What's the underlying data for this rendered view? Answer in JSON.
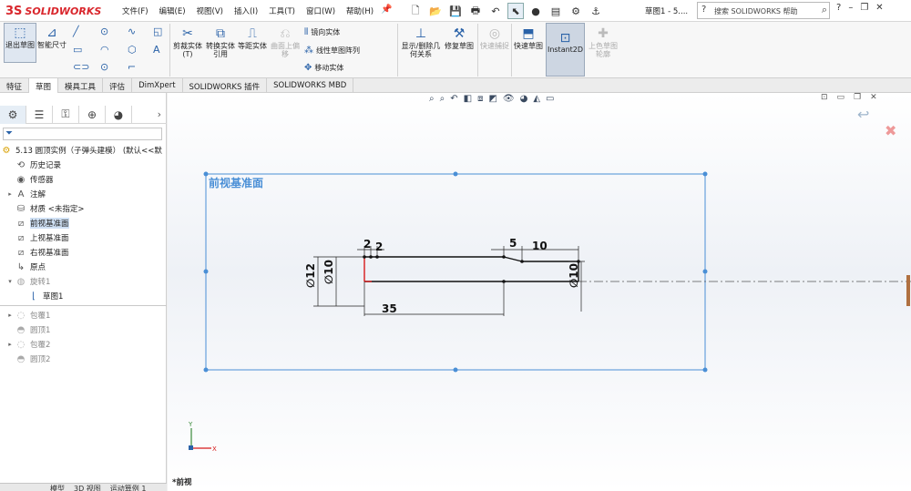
{
  "app": {
    "logo_mark": "3S",
    "logo_text": "SOLIDWORKS"
  },
  "menus": [
    "文件(F)",
    "编辑(E)",
    "视图(V)",
    "插入(I)",
    "工具(T)",
    "窗口(W)",
    "帮助(H)"
  ],
  "quick_icons": [
    "new-icon",
    "open-icon",
    "save-icon",
    "print-icon",
    "undo-icon",
    "select-icon",
    "traffic-light-icon",
    "options-icon",
    "gear-icon",
    "anchor-icon"
  ],
  "document_title": "草图1 - 5....",
  "search": {
    "placeholder": "搜索 SOLIDWORKS 帮助"
  },
  "ribbon": {
    "exit_sketch": "退出草图",
    "smart_dim": "智能尺寸",
    "trim": "剪裁实体(T)",
    "convert": "转换实体引用",
    "offset": "等距实体",
    "surface_offset": "曲面上偏移",
    "mirror": "镜向实体",
    "linear_pattern": "线性草图阵列",
    "move": "移动实体",
    "show_delete": "显示/删除几何关系",
    "repair": "修复草图",
    "quick_snap": "快速捕捉",
    "rapid_sketch": "快速草图",
    "instant2d": "Instant2D",
    "shaded": "上色草图轮廓"
  },
  "tabs": [
    "特征",
    "草图",
    "模具工具",
    "评估",
    "DimXpert",
    "SOLIDWORKS 插件",
    "SOLIDWORKS MBD"
  ],
  "active_tab": "草图",
  "tree": {
    "root": "5.13 圆顶实例（子弹头建模） (默认<<默",
    "items": [
      {
        "label": "历史记录"
      },
      {
        "label": "传感器"
      },
      {
        "label": "注解"
      },
      {
        "label": "材质 <未指定>"
      },
      {
        "label": "前视基准面"
      },
      {
        "label": "上视基准面"
      },
      {
        "label": "右视基准面"
      },
      {
        "label": "原点"
      },
      {
        "label": "旋转1"
      },
      {
        "label": "草图1"
      },
      {
        "label": "包覆1"
      },
      {
        "label": "圆顶1"
      },
      {
        "label": "包覆2"
      },
      {
        "label": "圆顶2"
      }
    ]
  },
  "bottom_tabs": [
    "模型",
    "3D 视图",
    "运动算例 1"
  ],
  "graphics": {
    "plane_label": "前视基准面",
    "view_label": "*前视",
    "dimensions": {
      "d_2a": "2",
      "d_2b": "2",
      "d_5": "5",
      "d_10": "10",
      "d_dia12": "∅12",
      "d_dia10a": "∅10",
      "d_dia10b": "∅10",
      "d_35": "35"
    }
  },
  "colors": {
    "accent": "#2a62a8",
    "plane": "#4a8fd6",
    "logo": "#d9262c"
  }
}
